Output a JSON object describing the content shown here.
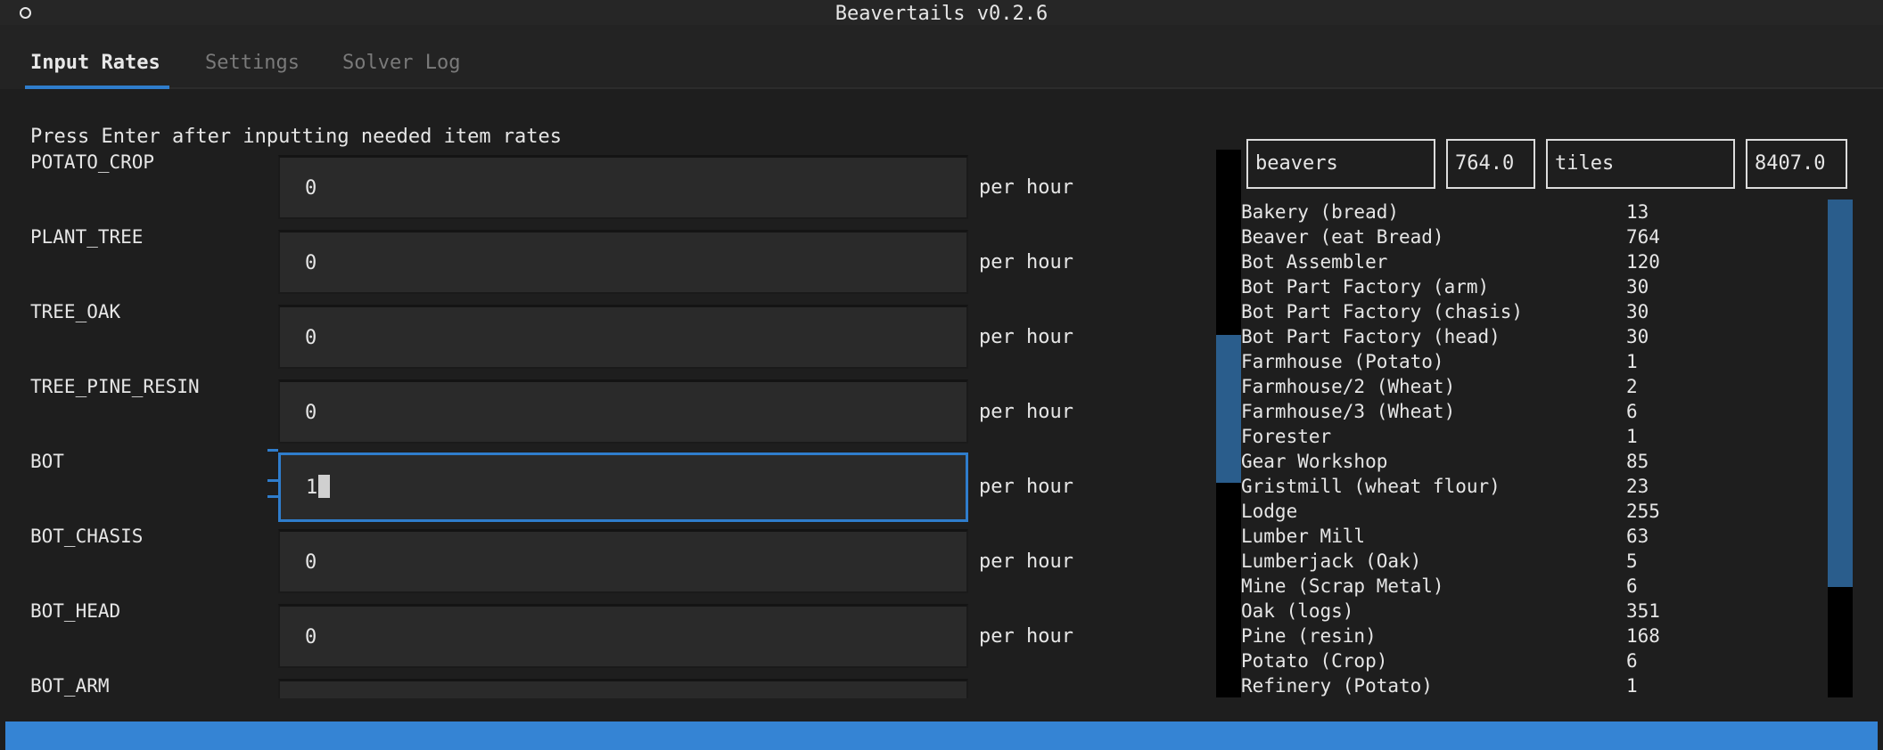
{
  "window": {
    "title": "Beavertails v0.2.6"
  },
  "tabs": [
    {
      "label": "Input Rates",
      "active": true
    },
    {
      "label": "Settings",
      "active": false
    },
    {
      "label": "Solver Log",
      "active": false
    }
  ],
  "instructions": "Press Enter after inputting needed item rates",
  "unit_label": "per hour",
  "inputs": [
    {
      "label": "POTATO_CROP",
      "value": "0"
    },
    {
      "label": "PLANT_TREE",
      "value": "0"
    },
    {
      "label": "TREE_OAK",
      "value": "0"
    },
    {
      "label": "TREE_PINE_RESIN",
      "value": "0"
    },
    {
      "label": "BOT",
      "value": "1",
      "focused": true
    },
    {
      "label": "BOT_CHASIS",
      "value": "0"
    },
    {
      "label": "BOT_HEAD",
      "value": "0"
    },
    {
      "label": "BOT_ARM",
      "value": ""
    }
  ],
  "summary": {
    "beavers_label": "beavers",
    "beavers_value": "764.0",
    "tiles_label": "tiles",
    "tiles_value": "8407.0"
  },
  "buildings": [
    {
      "name": "Bakery (bread)",
      "count": "13"
    },
    {
      "name": "Beaver (eat Bread)",
      "count": "764"
    },
    {
      "name": "Bot Assembler",
      "count": "120"
    },
    {
      "name": "Bot Part Factory (arm)",
      "count": "30"
    },
    {
      "name": "Bot Part Factory (chasis)",
      "count": "30"
    },
    {
      "name": "Bot Part Factory (head)",
      "count": "30"
    },
    {
      "name": "Farmhouse (Potato)",
      "count": "1"
    },
    {
      "name": "Farmhouse/2 (Wheat)",
      "count": "2"
    },
    {
      "name": "Farmhouse/3 (Wheat)",
      "count": "6"
    },
    {
      "name": "Forester",
      "count": "1"
    },
    {
      "name": "Gear Workshop",
      "count": "85"
    },
    {
      "name": "Gristmill (wheat flour)",
      "count": "23"
    },
    {
      "name": "Lodge",
      "count": "255"
    },
    {
      "name": "Lumber Mill",
      "count": "63"
    },
    {
      "name": "Lumberjack (Oak)",
      "count": "5"
    },
    {
      "name": "Mine (Scrap Metal)",
      "count": "6"
    },
    {
      "name": "Oak (logs)",
      "count": "351"
    },
    {
      "name": "Pine (resin)",
      "count": "168"
    },
    {
      "name": "Potato (Crop)",
      "count": "6"
    },
    {
      "name": "Refinery (Potato)",
      "count": "1"
    }
  ],
  "colors": {
    "accent": "#2f7dcc",
    "statusbar": "#3584d4",
    "background": "#1e1e1e"
  }
}
